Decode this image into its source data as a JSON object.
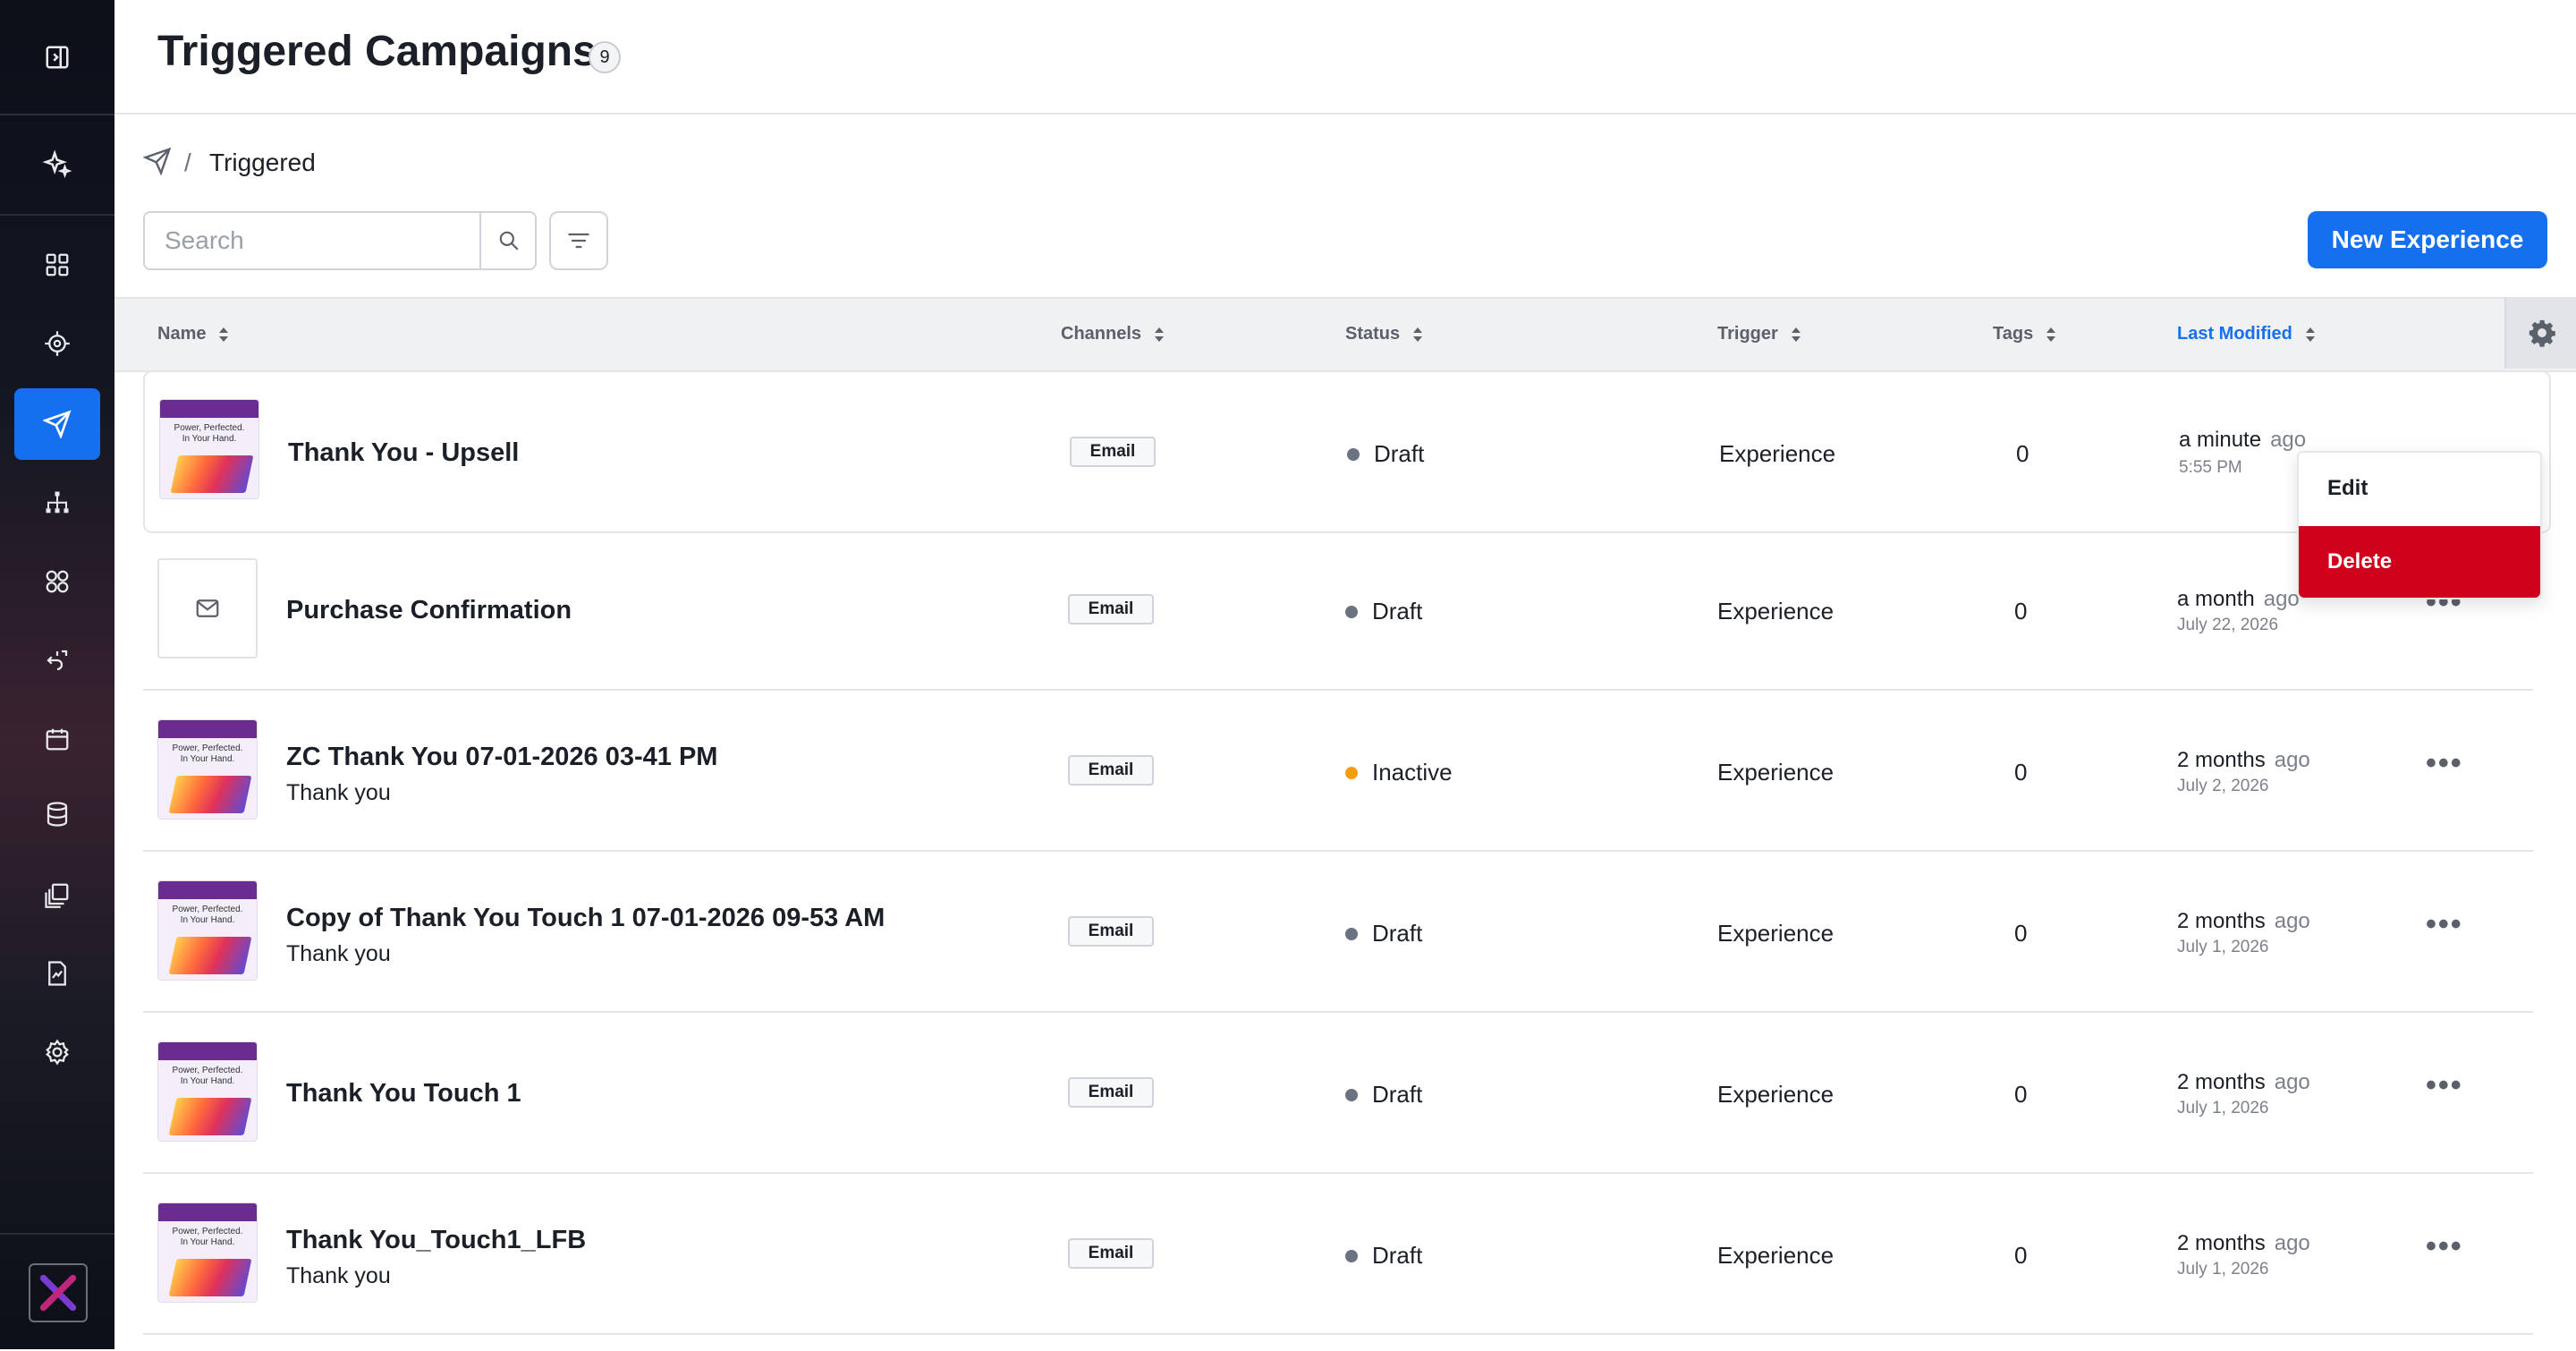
{
  "header": {
    "title": "Triggered Campaigns",
    "count": "9"
  },
  "breadcrumb": {
    "separator": "/",
    "label": "Triggered"
  },
  "toolbar": {
    "search_placeholder": "Search",
    "new_button_label": "New Experience"
  },
  "table": {
    "columns": [
      "Name",
      "Channels",
      "Status",
      "Trigger",
      "Tags",
      "Last Modified"
    ],
    "sorted_column": "Last Modified",
    "rows": [
      {
        "name": "Thank You - Upsell",
        "subtitle": "",
        "channel": "Email",
        "status": "Draft",
        "trigger": "Experience",
        "tags": "0",
        "modified_rel": "a minute",
        "modified_ago": "ago",
        "modified_abs": "5:55 PM"
      },
      {
        "name": "Purchase Confirmation",
        "subtitle": "",
        "channel": "Email",
        "status": "Draft",
        "trigger": "Experience",
        "tags": "0",
        "modified_rel": "a month",
        "modified_ago": "ago",
        "modified_abs": "July 22, 2026"
      },
      {
        "name": "ZC Thank You 07-01-2026 03-41 PM",
        "subtitle": "Thank you",
        "channel": "Email",
        "status": "Inactive",
        "trigger": "Experience",
        "tags": "0",
        "modified_rel": "2 months",
        "modified_ago": "ago",
        "modified_abs": "July 2, 2026"
      },
      {
        "name": "Copy of Thank You Touch 1 07-01-2026 09-53 AM",
        "subtitle": "Thank you",
        "channel": "Email",
        "status": "Draft",
        "trigger": "Experience",
        "tags": "0",
        "modified_rel": "2 months",
        "modified_ago": "ago",
        "modified_abs": "July 1, 2026"
      },
      {
        "name": "Thank You Touch 1",
        "subtitle": "",
        "channel": "Email",
        "status": "Draft",
        "trigger": "Experience",
        "tags": "0",
        "modified_rel": "2 months",
        "modified_ago": "ago",
        "modified_abs": "July 1, 2026"
      },
      {
        "name": "Thank You_Touch1_LFB",
        "subtitle": "Thank you",
        "channel": "Email",
        "status": "Draft",
        "trigger": "Experience",
        "tags": "0",
        "modified_rel": "2 months",
        "modified_ago": "ago",
        "modified_abs": "July 1, 2026"
      }
    ]
  },
  "thumbnail": {
    "text": "Power, Perfected.\nIn Your Hand."
  },
  "context_menu": {
    "edit": "Edit",
    "delete": "Delete"
  },
  "colors": {
    "accent": "#1570ef",
    "danger": "#d0021b",
    "inactive": "#f59e0b",
    "draft": "#6b7280"
  },
  "sidebar_icons": [
    "panel-toggle-icon",
    "sparkle-icon",
    "dashboard-icon",
    "target-icon",
    "send-icon",
    "hierarchy-icon",
    "segments-icon",
    "journey-icon",
    "calendar-icon",
    "database-icon",
    "assets-icon",
    "reports-icon",
    "settings-icon"
  ]
}
